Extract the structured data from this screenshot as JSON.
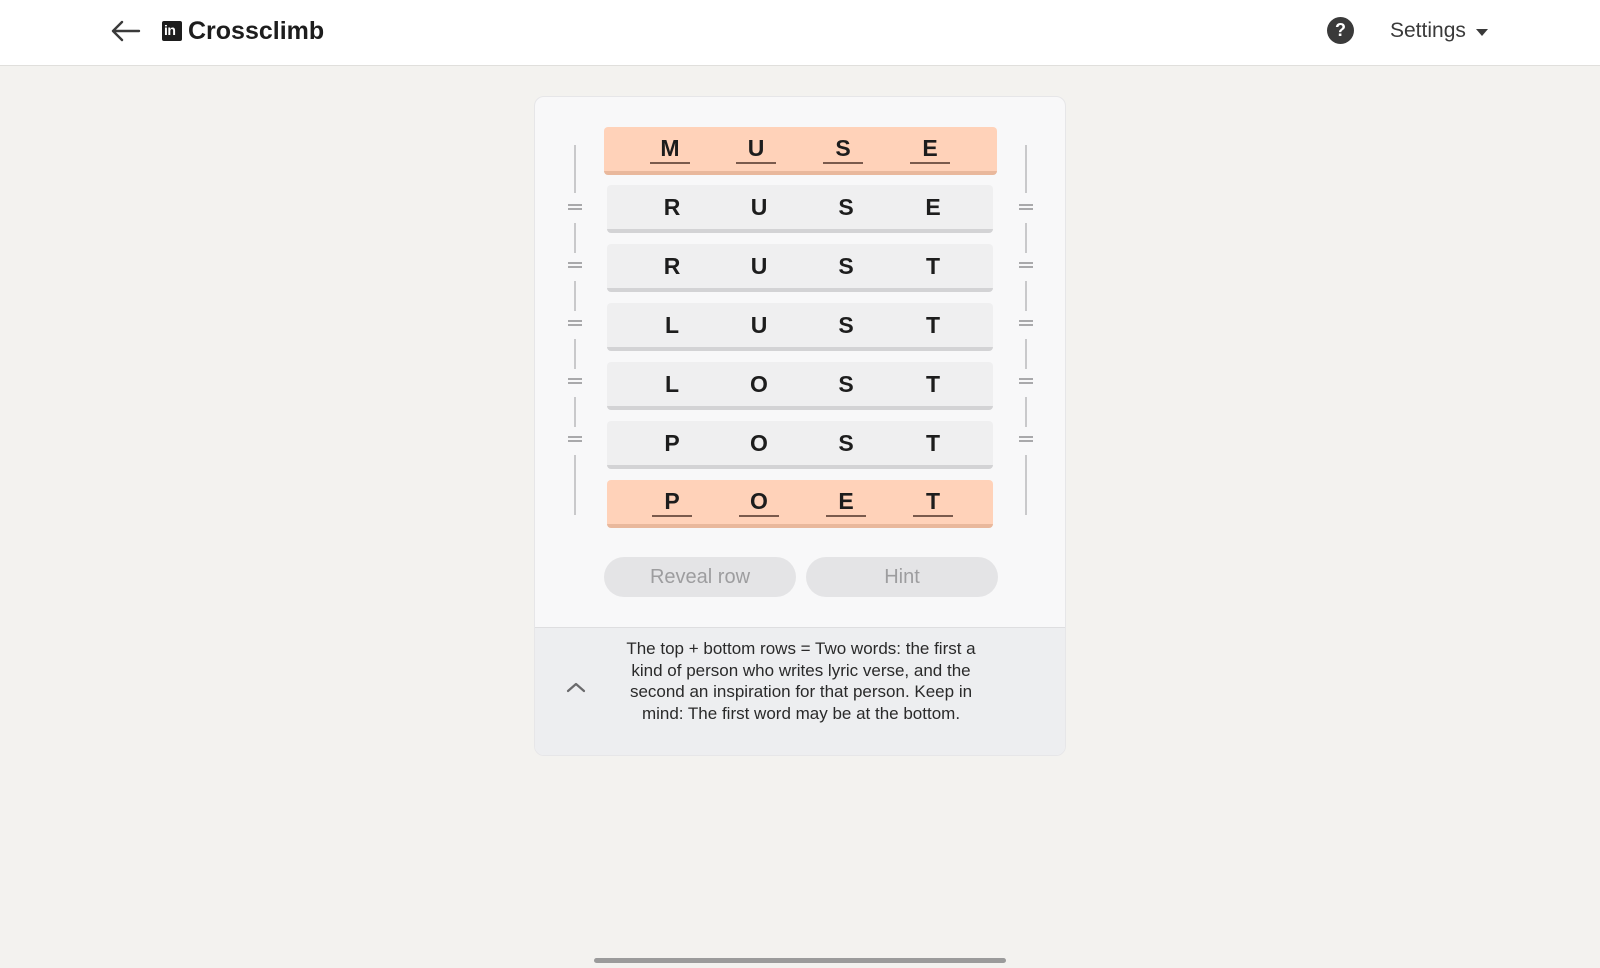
{
  "header": {
    "title": "Crossclimb",
    "logo_text": "in",
    "help_symbol": "?",
    "settings_label": "Settings"
  },
  "puzzle": {
    "rows": [
      {
        "letters": [
          "M",
          "U",
          "S",
          "E"
        ],
        "locked": true
      },
      {
        "letters": [
          "R",
          "U",
          "S",
          "E"
        ],
        "locked": false
      },
      {
        "letters": [
          "R",
          "U",
          "S",
          "T"
        ],
        "locked": false
      },
      {
        "letters": [
          "L",
          "U",
          "S",
          "T"
        ],
        "locked": false
      },
      {
        "letters": [
          "L",
          "O",
          "S",
          "T"
        ],
        "locked": false
      },
      {
        "letters": [
          "P",
          "O",
          "S",
          "T"
        ],
        "locked": false
      },
      {
        "letters": [
          "P",
          "O",
          "E",
          "T"
        ],
        "locked": true
      }
    ]
  },
  "buttons": {
    "reveal_label": "Reveal row",
    "hint_label": "Hint"
  },
  "clue": {
    "text": "The top + bottom rows = Two words: the first a kind of person who writes lyric verse, and the second an inspiration for that person. Keep in mind: The first word may be at the bottom."
  },
  "colors": {
    "locked_row": "#ffd2b9",
    "row": "#efeff0",
    "page_bg": "#f3f2ef"
  },
  "icons": {
    "back": "arrow-left-icon",
    "help": "question-circle-icon",
    "settings_caret": "caret-down-icon",
    "collapse": "chevron-up-icon",
    "drag_handle": "drag-handle-icon"
  }
}
